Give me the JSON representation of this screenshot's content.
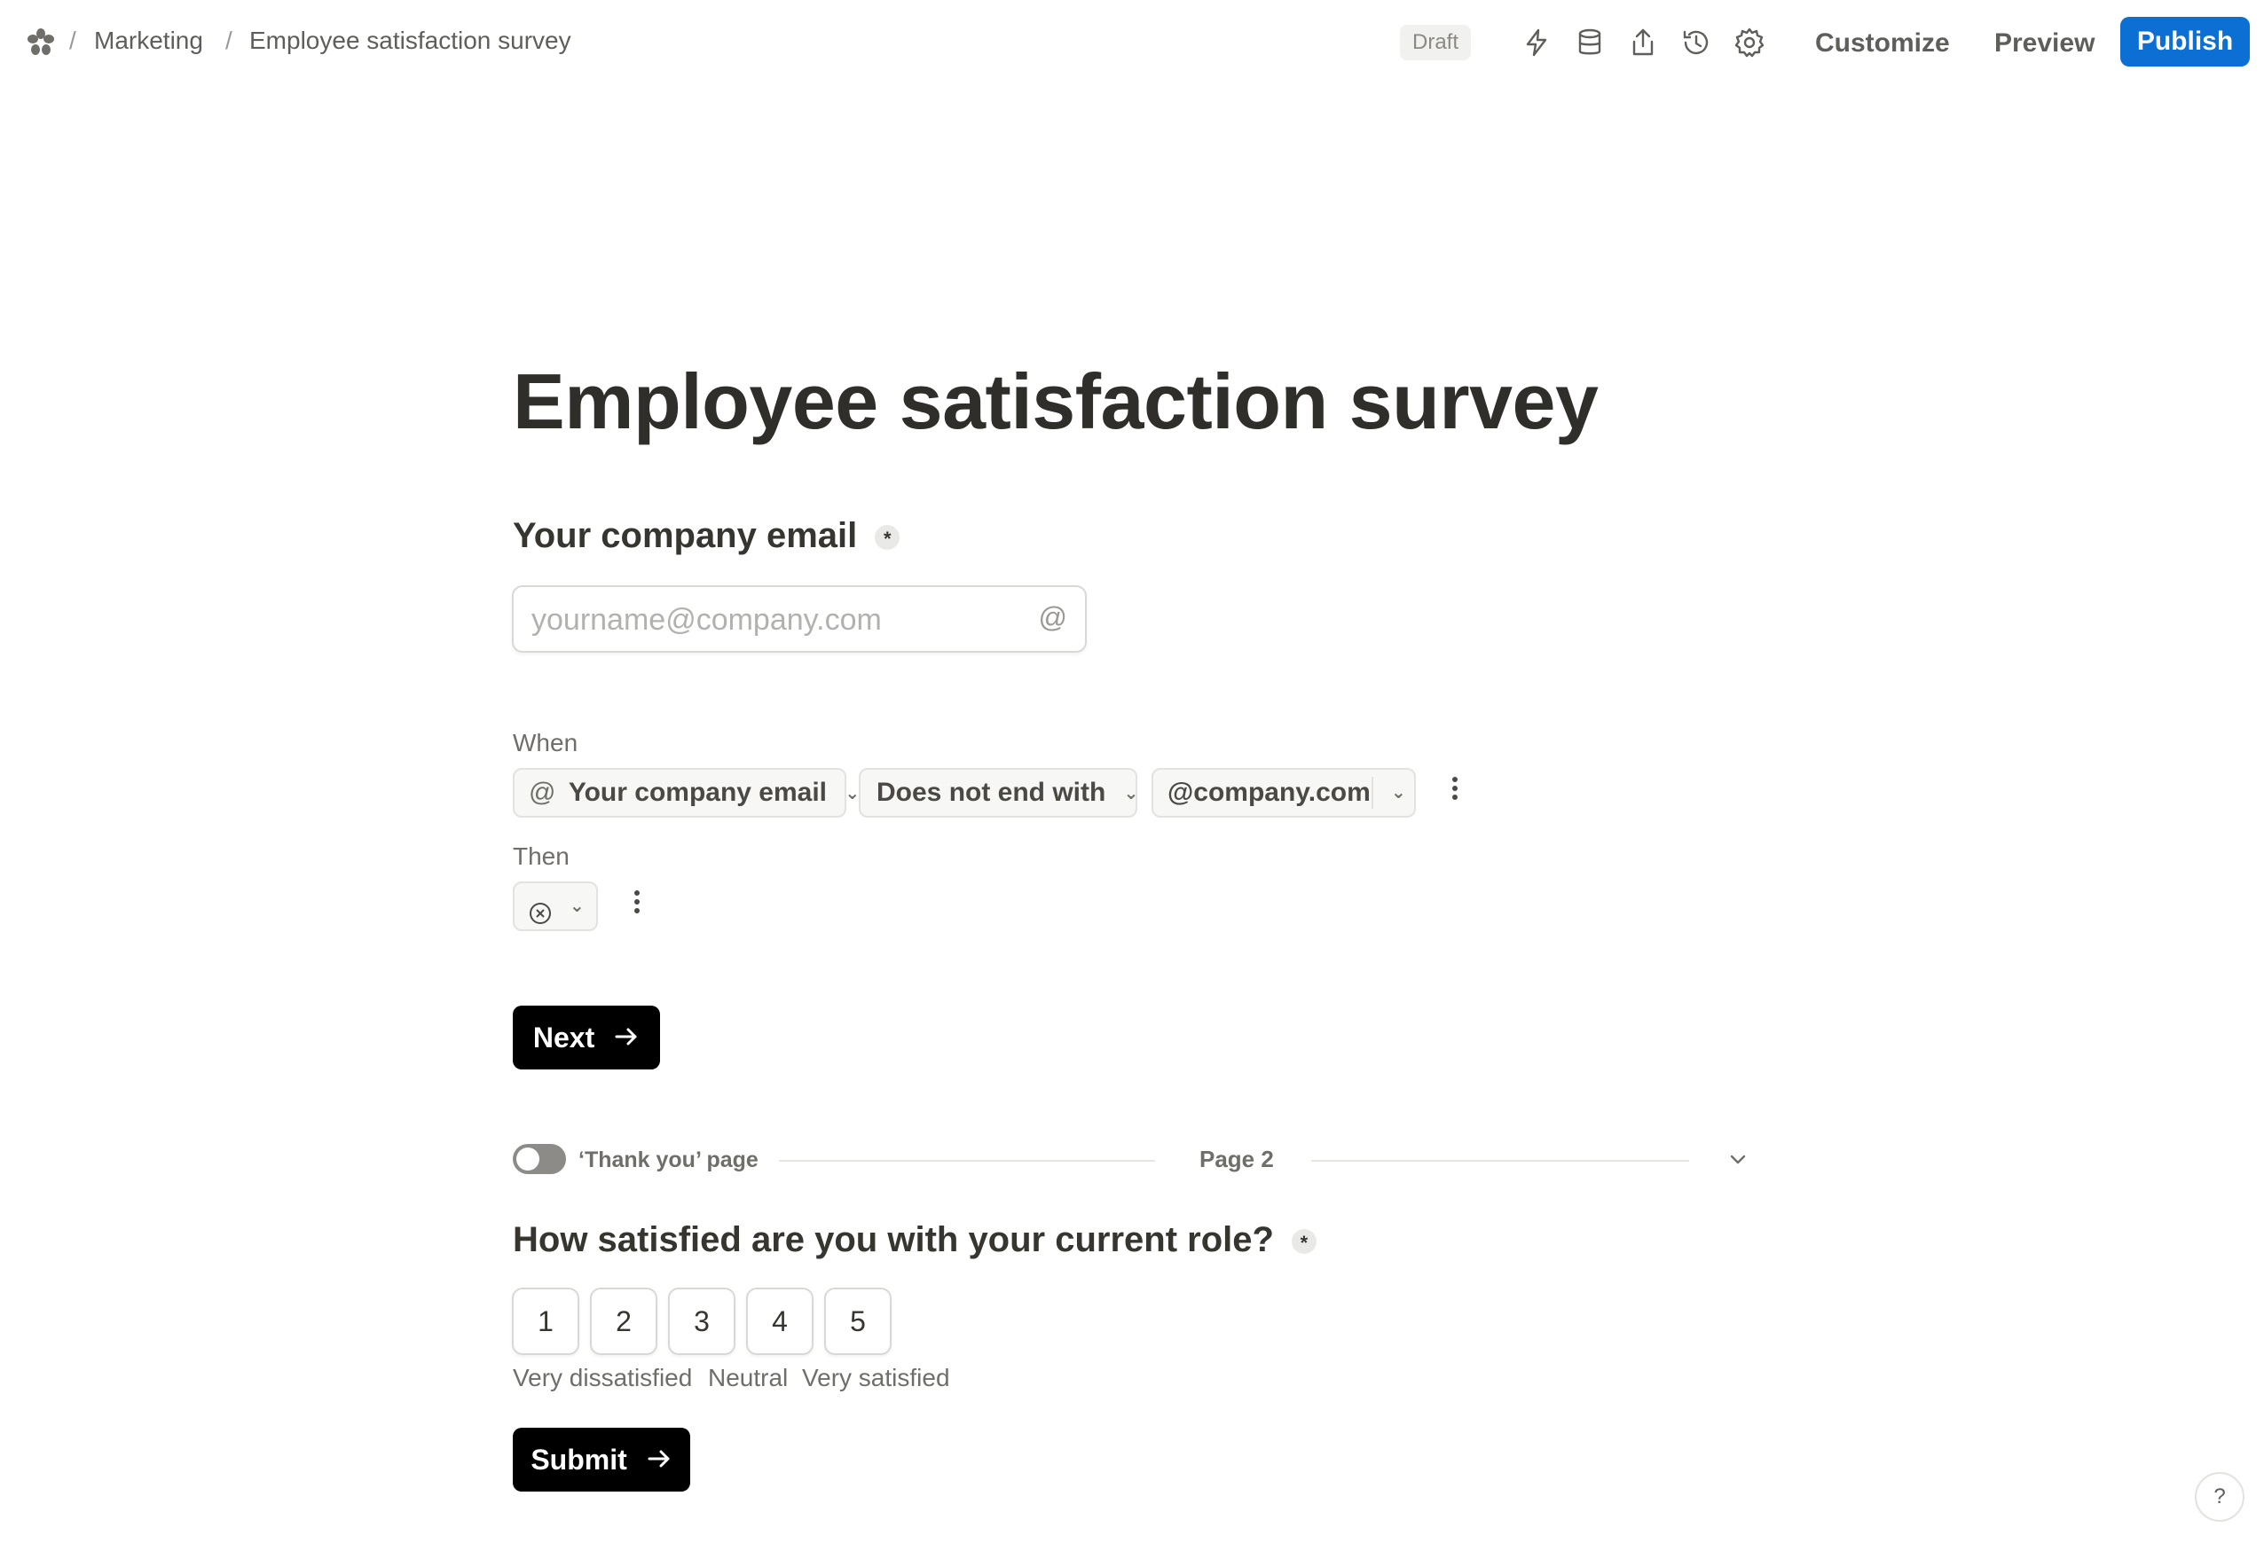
{
  "breadcrumb": {
    "workspace": "Marketing",
    "page": "Employee satisfaction survey",
    "separator": "/"
  },
  "toolbar": {
    "status": "Draft",
    "customize_label": "Customize",
    "preview_label": "Preview",
    "publish_label": "Publish",
    "icons": [
      "lightning-icon",
      "database-icon",
      "share-icon",
      "history-icon",
      "gear-icon"
    ]
  },
  "form": {
    "title": "Employee satisfaction survey",
    "q1": {
      "label": "Your company email",
      "required_mark": "*",
      "placeholder": "yourname@company.com",
      "suffix_icon": "@"
    },
    "logic": {
      "when_label": "When",
      "field": "Your company email",
      "field_icon": "@",
      "operator": "Does not end with",
      "value": "@company.com",
      "then_label": "Then"
    },
    "next_label": "Next",
    "page_break": {
      "thank_you_label": "‘Thank you’ page",
      "page_label": "Page 2"
    },
    "q2": {
      "label": "How satisfied are you with your current role?",
      "required_mark": "*",
      "options": [
        "1",
        "2",
        "3",
        "4",
        "5"
      ],
      "low_label": "Very dissatisfied",
      "mid_label": "Neutral",
      "high_label": "Very satisfied"
    },
    "submit_label": "Submit"
  },
  "help_label": "?",
  "colors": {
    "publish": "#0b6fd4",
    "primary_button": "#000000",
    "text": "#37352f"
  }
}
